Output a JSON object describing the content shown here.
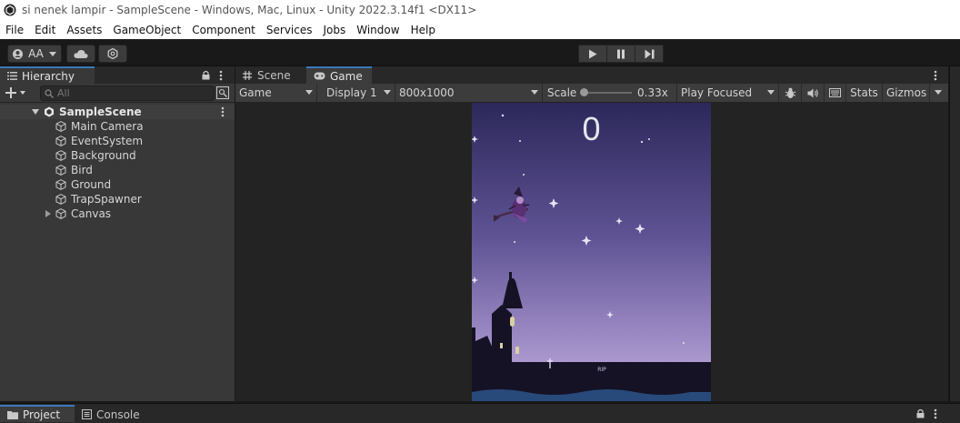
{
  "window": {
    "title": "si nenek lampir - SampleScene - Windows, Mac, Linux - Unity 2022.3.14f1 <DX11>"
  },
  "menu": [
    "File",
    "Edit",
    "Assets",
    "GameObject",
    "Component",
    "Services",
    "Jobs",
    "Window",
    "Help"
  ],
  "toolbar": {
    "account_label": "AA",
    "icons": [
      "account-icon",
      "cloud-icon",
      "settings-icon"
    ],
    "play_controls": [
      "play-icon",
      "pause-icon",
      "step-icon"
    ]
  },
  "hierarchy": {
    "tab_label": "Hierarchy",
    "search_placeholder": "All",
    "scene_name": "SampleScene",
    "items": [
      {
        "label": "Main Camera"
      },
      {
        "label": "EventSystem"
      },
      {
        "label": "Background"
      },
      {
        "label": "Bird"
      },
      {
        "label": "Ground"
      },
      {
        "label": "TrapSpawner"
      },
      {
        "label": "Canvas"
      }
    ]
  },
  "view_tabs": {
    "scene_label": "Scene",
    "game_label": "Game"
  },
  "game_toolbar": {
    "mode": "Game",
    "display": "Display 1",
    "resolution": "800x1000",
    "scale_label": "Scale",
    "scale_value": "0.33x",
    "play_focus": "Play Focused",
    "stats_label": "Stats",
    "gizmos_label": "Gizmos"
  },
  "game": {
    "score": "0"
  },
  "bottom_tabs": {
    "project_label": "Project",
    "console_label": "Console"
  },
  "colors": {
    "accent": "#3a79bb",
    "panel": "#383838",
    "sky_top": "#2e2a5a",
    "sky_bottom": "#b7a3d6"
  }
}
